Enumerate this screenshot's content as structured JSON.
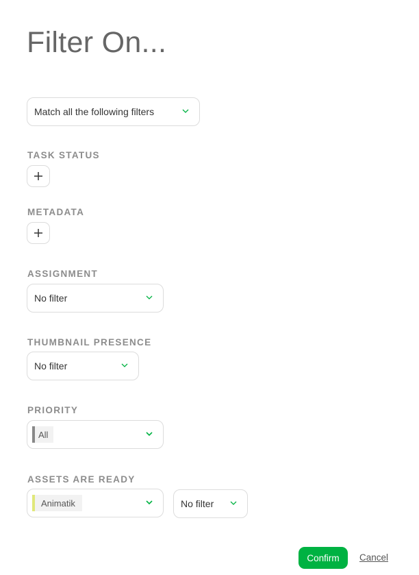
{
  "title": "Filter On...",
  "match_mode": {
    "value": "Match all the following filters"
  },
  "sections": {
    "task_status": {
      "label": "TASK STATUS"
    },
    "metadata": {
      "label": "METADATA"
    },
    "assignment": {
      "label": "ASSIGNMENT",
      "value": "No filter"
    },
    "thumbnail_presence": {
      "label": "THUMBNAIL PRESENCE",
      "value": "No filter"
    },
    "priority": {
      "label": "PRIORITY",
      "value": "All",
      "color": "#888888"
    },
    "assets_are_ready": {
      "label": "ASSETS ARE READY",
      "task_type": "Animatik",
      "task_type_color": "#e0e87a",
      "value": "No filter"
    }
  },
  "icons": {
    "add": "plus-icon",
    "dropdown": "chevron-down-icon"
  },
  "accent_color": "#00b242",
  "buttons": {
    "confirm": "Confirm",
    "cancel": "Cancel"
  }
}
